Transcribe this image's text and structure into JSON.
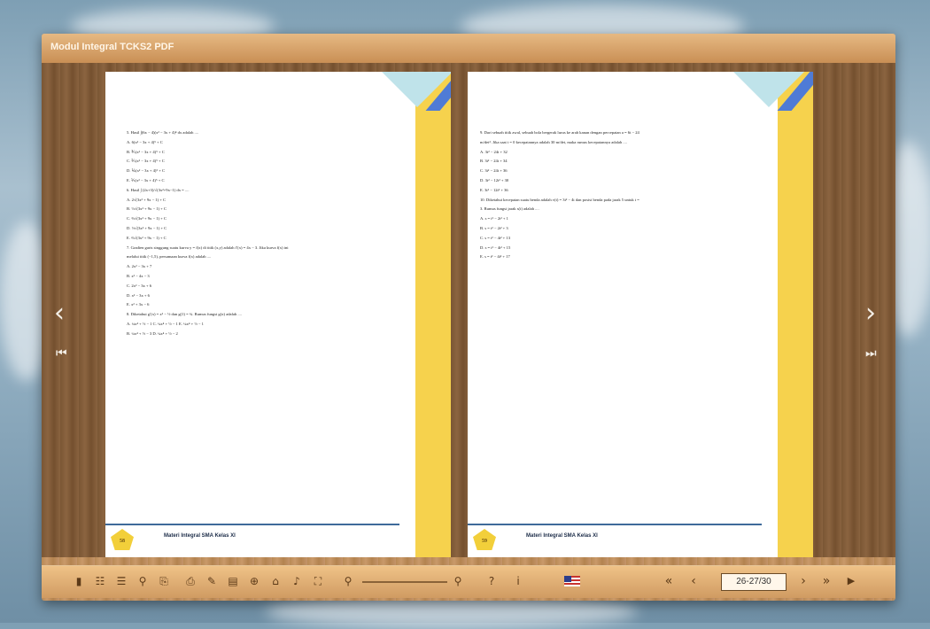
{
  "app": {
    "title": "Modul Integral TCKS2 PDF"
  },
  "left_page": {
    "page_number": "58",
    "footer": "Materi Integral SMA Kelas XI",
    "lines": [
      "5. Hasil ∫(6x − 4)(x² − 3x + 4)⁴ dx adalah ....",
      "A. 6(x² − 3x + 4)⁵ + C",
      "B. ⅗(x² − 3x + 4)⁵ + C",
      "C. ⅖(x² − 3x + 4)⁵ + C",
      "D. ⅙(x² − 3x + 4)⁵ + C",
      "E. ⅕(x² − 3x + 4)⁵ + C",
      "6. Hasil ∫ (2x+3)/√(3x²+9x−1) dx = ....",
      "A. 2√(3x² + 9x − 1) + C",
      "B. ⅓√(3x² + 9x − 1) + C",
      "C. ⅔√(3x² + 9x − 1) + C",
      "D. ½√(3x² + 9x − 1) + C",
      "E. ⅔√(3x² + 9x − 1) + C",
      "7. Gradien garis singgung suatu kurva y = f(x) di titik (x,y) adalah f′(x) = 4x − 3. Jika kurva f(x) ini",
      "melalui titik (−1,5), persamaan kurva f(x) adalah ....",
      "A. 2x² − 3x + 7",
      "B. x² − 4x − 3",
      "C. 2x² − 3x + 6",
      "D. x² − 3x + 6",
      "E. x² + 3x − 6",
      "8. Diketahui g′(x) = x³ − ½ dan g(1) = ¾. Rumus fungsi g(x) adalah ....",
      "A. ¼x⁴ + ½ − 1        C. ¼x⁴ + ½ − 1        E. ¼x⁴ + ½ − 1",
      "B. ¼x⁴ + ½ − 3        D. ¼x⁴ + ½ − 2"
    ]
  },
  "right_page": {
    "page_number": "59",
    "footer": "Materi Integral SMA Kelas XI",
    "lines": [
      "9. Dari sebuah titik awal, sebuah bola bergerak lurus ke arah kanan dengan percepatan a = 6t − 24",
      "m/det². Jika saat t = 0 kecepatannya adalah 30 m/det, maka rumus kecepatannya adalah ....",
      "A. 3t² − 24t + 32",
      "B. 3t² − 24t + 34",
      "C. 3t² − 24t + 36",
      "D. 3t² − 12t² + 30",
      "E. 3t² − 12t² + 36",
      "10. Diketahui kecepatan suatu benda adalah v(t) = 3t² − 4t dan posisi benda pada jarak 5 untuk t =",
      "3. Rumus fungsi jarak s(t) adalah ....",
      "A. s = t³ − 2t² + 1",
      "B. s = t³ − 2t² + 3",
      "C. s = t³ − 4t² + 13",
      "D. s = t³ − 4t² + 15",
      "E. s = t³ − 4t² + 17"
    ]
  },
  "navigation": {
    "prev_icon": "chevron-left-icon",
    "next_icon": "chevron-right-icon",
    "first_icon": "skip-first-icon",
    "last_icon": "skip-last-icon"
  },
  "toolbar": {
    "page_indicator": "26-27/30",
    "icons": [
      "bookmark-icon",
      "thumbnails-icon",
      "table-of-contents-icon",
      "search-icon",
      "share-icon",
      "print-icon",
      "pen-icon",
      "note-icon",
      "download-icon",
      "home-icon",
      "sound-icon",
      "fullscreen-icon",
      "zoom-out-icon",
      "zoom-in-icon",
      "help-icon",
      "info-icon",
      "language-flag-icon",
      "first-page-icon",
      "previous-page-icon",
      "next-page-icon",
      "last-page-icon",
      "autoplay-icon"
    ]
  },
  "colors": {
    "frame": "#c9996a",
    "toolbar": "#d09b62",
    "stripe": "#f6d24d",
    "footer_line": "#3e6a9a"
  }
}
